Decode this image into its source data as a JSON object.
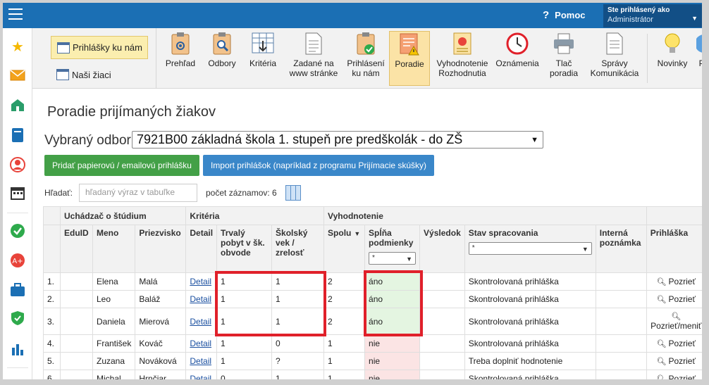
{
  "topbar": {
    "help_label": "Pomoc",
    "user_line1": "Ste prihlásený ako",
    "user_line2": "Administrátor"
  },
  "toolbar": {
    "prihlasky_label": "Prihlášky ku nám",
    "ziaci_label": "Naši žiaci",
    "items": [
      {
        "label": "Prehľad"
      },
      {
        "label": "Odbory"
      },
      {
        "label": "Kritéria"
      },
      {
        "label": "Zadané na\nwww stránke"
      },
      {
        "label": "Prihlásení\nku nám"
      },
      {
        "label": "Poradie"
      },
      {
        "label": "Vyhodnotenie\nRozhodnutia"
      },
      {
        "label": "Oznámenia"
      },
      {
        "label": "Tlač\nporadia"
      },
      {
        "label": "Správy\nKomunikácia"
      },
      {
        "label": "Novinky"
      },
      {
        "label": "Po"
      }
    ]
  },
  "page": {
    "title": "Poradie prijímaných žiakov",
    "odbor_label": "Vybraný odbor:",
    "odbor_value": "7921B00 základná škola 1. stupeň pre predškolák - do ZŠ",
    "btn_add": "Pridať papierovú / emailovú prihlášku",
    "btn_import": "Import prihlášok (napríklad z programu Prijímacie skúšky)",
    "search_label": "Hľadať:",
    "search_placeholder": "hľadaný výraz v tabuľke",
    "count_label": "počet záznamov: 6"
  },
  "table": {
    "groups": {
      "uchadzac": "Uchádzač o štúdium",
      "kriteria": "Kritéria",
      "vyhodnotenie": "Vyhodnotenie"
    },
    "headers": {
      "eduid": "EduID",
      "meno": "Meno",
      "priezvisko": "Priezvisko",
      "detail": "Detail",
      "trvaly": "Trvalý pobyt v šk. obvode",
      "skolsky": "Školský vek / zrelosť",
      "spolu": "Spolu",
      "splna": "Spĺňa podmienky",
      "vysledok": "Výsledok",
      "stav": "Stav spracovania",
      "poznamka": "Interná poznámka",
      "prihlaska": "Prihláška"
    },
    "filter_value": "*",
    "rows": [
      {
        "n": "1.",
        "meno": "Elena",
        "priezvisko": "Malá",
        "detail": "Detail",
        "trvaly": "1",
        "skolsky": "1",
        "spolu": "2",
        "splna": "áno",
        "splna_ok": true,
        "stav": "Skontrolovaná prihláška",
        "prihlaska": "Pozrieť"
      },
      {
        "n": "2.",
        "meno": "Leo",
        "priezvisko": "Baláž",
        "detail": "Detail",
        "trvaly": "1",
        "skolsky": "1",
        "spolu": "2",
        "splna": "áno",
        "splna_ok": true,
        "stav": "Skontrolovaná prihláška",
        "prihlaska": "Pozrieť"
      },
      {
        "n": "3.",
        "meno": "Daniela",
        "priezvisko": "Mierová",
        "detail": "Detail",
        "trvaly": "1",
        "skolsky": "1",
        "spolu": "2",
        "splna": "áno",
        "splna_ok": true,
        "stav": "Skontrolovaná prihláška",
        "prihlaska": "Pozrieť/meniť"
      },
      {
        "n": "4.",
        "meno": "František",
        "priezvisko": "Kováč",
        "detail": "Detail",
        "trvaly": "1",
        "skolsky": "0",
        "spolu": "1",
        "splna": "nie",
        "splna_ok": false,
        "stav": "Skontrolovaná prihláška",
        "prihlaska": "Pozrieť"
      },
      {
        "n": "5.",
        "meno": "Zuzana",
        "priezvisko": "Nováková",
        "detail": "Detail",
        "trvaly": "1",
        "skolsky": "?",
        "spolu": "1",
        "splna": "nie",
        "splna_ok": false,
        "stav": "Treba doplniť hodnotenie",
        "prihlaska": "Pozrieť"
      },
      {
        "n": "6.",
        "meno": "Michal",
        "priezvisko": "Hrnčiar",
        "detail": "Detail",
        "trvaly": "0",
        "skolsky": "1",
        "spolu": "1",
        "splna": "nie",
        "splna_ok": false,
        "stav": "Skontrolovaná prihláška",
        "prihlaska": "Pozrieť"
      }
    ]
  },
  "colors": {
    "topbar": "#1b6fb4",
    "highlight": "#e0202a",
    "ok_bg": "#e4f5e1",
    "bad_bg": "#fbe4e4"
  }
}
